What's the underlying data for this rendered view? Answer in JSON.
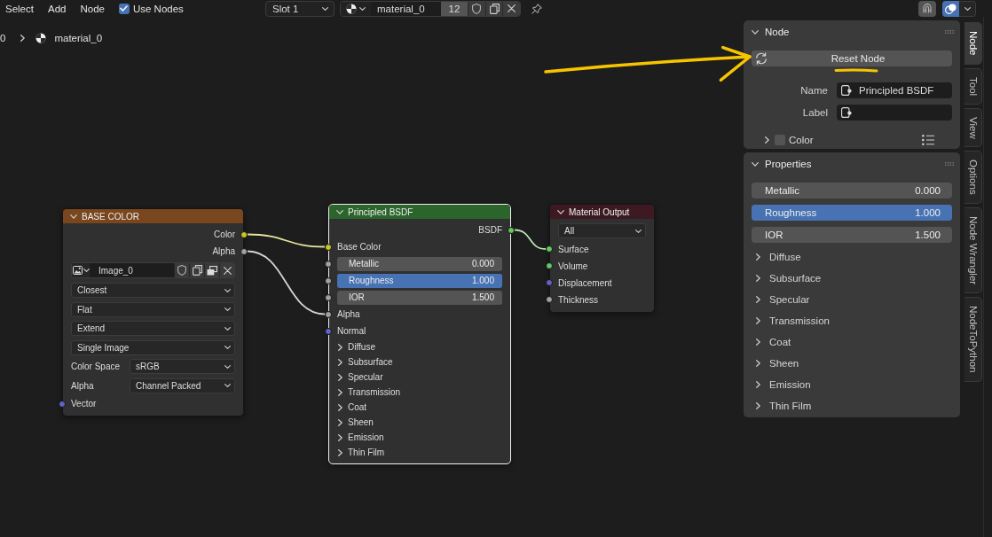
{
  "header": {
    "menus": [
      {
        "label": "Select"
      },
      {
        "label": "Add"
      },
      {
        "label": "Node"
      }
    ],
    "use_nodes": {
      "label": "Use Nodes",
      "checked": true
    },
    "slot": {
      "value": "Slot 1"
    },
    "material": {
      "name": "material_0",
      "users": "12",
      "fake_user": false,
      "pinned": false
    },
    "view_toggles": [
      {
        "kind": "snap",
        "on": false
      },
      {
        "kind": "overlay",
        "on": true
      }
    ]
  },
  "breadcrumb": [
    {
      "kind": "item",
      "label": "0"
    },
    {
      "kind": "material",
      "label": "material_0"
    }
  ],
  "nodes": [
    {
      "title": "BASE COLOR",
      "color": "#79461d",
      "selected": false,
      "expanded": true,
      "rows": [
        {
          "kind": "output",
          "label": "Color",
          "color": "#c7c729"
        },
        {
          "kind": "output",
          "label": "Alpha",
          "color": "#a1a1a1"
        },
        {
          "kind": "image",
          "value": "Image_0"
        },
        {
          "kind": "dropdown",
          "value": "Closest"
        },
        {
          "kind": "dropdown",
          "value": "Flat"
        },
        {
          "kind": "dropdown",
          "value": "Extend"
        },
        {
          "kind": "dropdown",
          "value": "Single Image"
        },
        {
          "kind": "dropdown",
          "label": "Color Space",
          "value": "sRGB"
        },
        {
          "kind": "dropdown",
          "label": "Alpha",
          "value": "Channel Packed"
        },
        {
          "kind": "input",
          "label": "Vector",
          "color": "#6363c7"
        }
      ]
    },
    {
      "title": "Principled BSDF",
      "color": "#2b652b",
      "selected": true,
      "expanded": true,
      "rows": [
        {
          "kind": "output",
          "label": "BSDF",
          "color": "#63c763"
        },
        {
          "kind": "input",
          "label": "Base Color",
          "color": "#c7c729",
          "linked": true
        },
        {
          "kind": "slider",
          "label": "Metallic",
          "value": "0.000",
          "level": 0,
          "color": "#a1a1a1"
        },
        {
          "kind": "slider",
          "label": "Roughness",
          "value": "1.000",
          "level": 1,
          "color": "#a1a1a1"
        },
        {
          "kind": "number",
          "label": "IOR",
          "value": "1.500",
          "color": "#a1a1a1"
        },
        {
          "kind": "input",
          "label": "Alpha",
          "color": "#a1a1a1",
          "linked": true
        },
        {
          "kind": "input",
          "label": "Normal",
          "color": "#6363c7"
        },
        {
          "kind": "panel",
          "label": "Diffuse",
          "expanded": false
        },
        {
          "kind": "panel",
          "label": "Subsurface",
          "expanded": false
        },
        {
          "kind": "panel",
          "label": "Specular",
          "expanded": false
        },
        {
          "kind": "panel",
          "label": "Transmission",
          "expanded": false
        },
        {
          "kind": "panel",
          "label": "Coat",
          "expanded": false
        },
        {
          "kind": "panel",
          "label": "Sheen",
          "expanded": false
        },
        {
          "kind": "panel",
          "label": "Emission",
          "expanded": false
        },
        {
          "kind": "panel",
          "label": "Thin Film",
          "expanded": false
        }
      ]
    },
    {
      "title": "Material Output",
      "color": "#3d1a22",
      "selected": false,
      "expanded": true,
      "rows": [
        {
          "kind": "dropdown",
          "value": "All"
        },
        {
          "kind": "input",
          "label": "Surface",
          "color": "#63c763",
          "linked": true
        },
        {
          "kind": "input",
          "label": "Volume",
          "color": "#63c763"
        },
        {
          "kind": "input",
          "label": "Displacement",
          "color": "#6363c7"
        },
        {
          "kind": "input",
          "label": "Thickness",
          "color": "#a1a1a1"
        }
      ]
    }
  ],
  "sidebar": {
    "panels": [
      {
        "kind": "node",
        "title": "Node",
        "expanded": true,
        "button": "Reset Node",
        "fields": [
          {
            "label": "Name",
            "value": "Principled BSDF"
          },
          {
            "label": "Label"
          }
        ],
        "subpanel": {
          "label": "Color",
          "expanded": false,
          "checked": false
        }
      },
      {
        "kind": "properties",
        "title": "Properties",
        "expanded": true,
        "items": [
          {
            "kind": "slider",
            "label": "Metallic",
            "value": "0.000"
          },
          {
            "kind": "slider",
            "label": "Roughness",
            "value": "1.000",
            "level": 1
          },
          {
            "kind": "number",
            "label": "IOR",
            "value": "1.500"
          },
          {
            "kind": "panel",
            "label": "Diffuse",
            "expanded": false
          },
          {
            "kind": "panel",
            "label": "Subsurface",
            "expanded": false
          },
          {
            "kind": "panel",
            "label": "Specular",
            "expanded": false
          },
          {
            "kind": "panel",
            "label": "Transmission",
            "expanded": false
          },
          {
            "kind": "panel",
            "label": "Coat",
            "expanded": false
          },
          {
            "kind": "panel",
            "label": "Sheen",
            "expanded": false
          },
          {
            "kind": "panel",
            "label": "Emission",
            "expanded": false
          },
          {
            "kind": "panel",
            "label": "Thin Film",
            "expanded": false
          }
        ]
      }
    ],
    "tabs": [
      {
        "label": "Node",
        "selected": true
      },
      {
        "label": "Tool",
        "selected": false
      },
      {
        "label": "View",
        "selected": false
      },
      {
        "label": "Options",
        "selected": false
      },
      {
        "label": "Node Wrangler",
        "selected": false
      },
      {
        "label": "NodeToPython",
        "selected": false
      }
    ]
  },
  "annotations": [
    {
      "kind": "arrow"
    },
    {
      "kind": "underline"
    }
  ]
}
